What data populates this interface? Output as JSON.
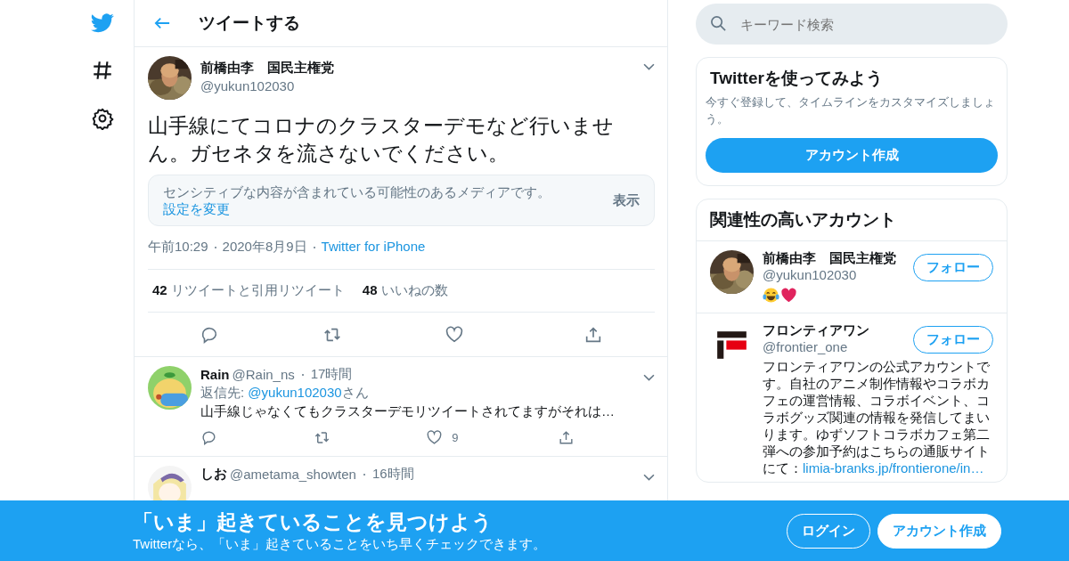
{
  "header": {
    "title": "ツイートする"
  },
  "tweet": {
    "name": "前橋由李　国民主権党",
    "handle": "@yukun102030",
    "text": "山手線にてコロナのクラスターデモなど行いません。ガセネタを流さないでください。",
    "sensitive": {
      "notice": "センシティブな内容が含まれている可能性のあるメディアです。",
      "link": "設定を変更",
      "button": "表示"
    },
    "time": "午前10:29",
    "date": "2020年8月9日",
    "source": "Twitter for iPhone",
    "stats": [
      {
        "count": "42",
        "label": "リツイートと引用リツイート"
      },
      {
        "count": "48",
        "label": "いいねの数"
      }
    ]
  },
  "replies": [
    {
      "name": "Rain",
      "handle": "@Rain_ns",
      "time": "17時間",
      "reply_label": "返信先:",
      "reply_to": "@yukun102030",
      "reply_suffix": "さん",
      "text": "山手線じゃなくてもクラスターデモリツイートされてますがそれは…",
      "likes": "9"
    },
    {
      "name": "しお",
      "handle": "@ametama_showten",
      "time": "16時間"
    }
  ],
  "search": {
    "placeholder": "キーワード検索"
  },
  "signup_card": {
    "title": "Twitterを使ってみよう",
    "text": "今すぐ登録して、タイムラインをカスタマイズしましょう。",
    "button": "アカウント作成"
  },
  "related": {
    "title": "関連性の高いアカウント",
    "accounts": [
      {
        "kind": "emoji",
        "name": "前橋由李　国民主権党",
        "handle": "@yukun102030",
        "follow": "フォロー"
      },
      {
        "kind": "text",
        "name": "フロンティアワン",
        "handle": "@frontier_one",
        "follow": "フォロー",
        "bio": "フロンティアワンの公式アカウントです。自社のアニメ制作情報やコラボカフェの運営情報、コラボイベント、コラボグッズ関連の情報を発信してまいります。ゆずソフトコラボカフェ第二弾への参加予約はこちらの通販サイトにて：",
        "bio_link": "limia-branks.jp/frontierone/in…"
      }
    ]
  },
  "banner": {
    "title": "「いま」起きていることを見つけよう",
    "subtitle": "Twitterなら、「いま」起きていることをいち早くチェックできます。",
    "login": "ログイン",
    "signup": "アカウント作成"
  }
}
